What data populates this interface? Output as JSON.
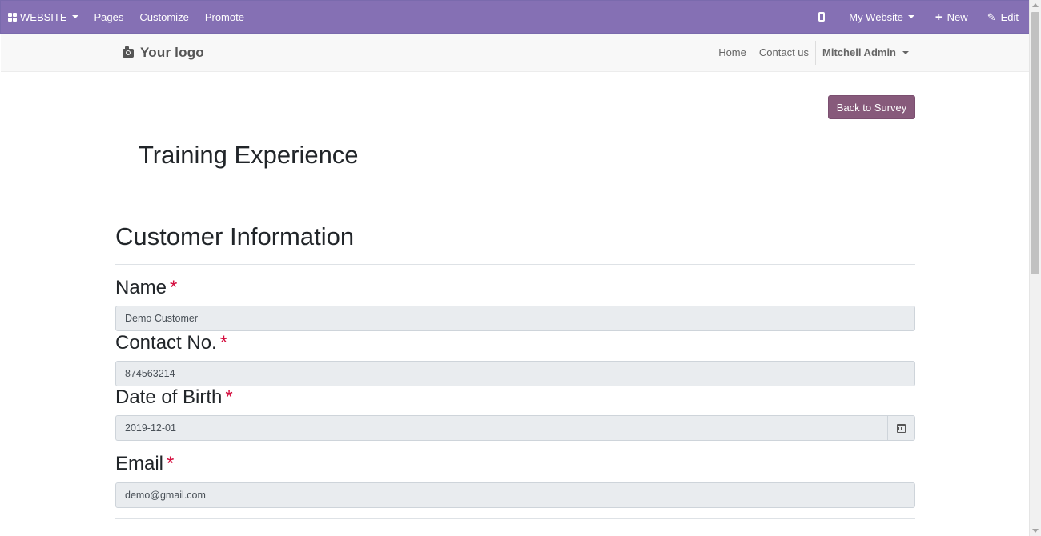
{
  "colors": {
    "accent": "#875A7B",
    "admin_bar": "#8570b4",
    "required": "#d40d3e"
  },
  "topbar": {
    "website_label": "WEBSITE",
    "website_icon": "grid-icon",
    "pages_label": "Pages",
    "customize_label": "Customize",
    "promote_label": "Promote",
    "mobile_icon": "mobile-icon",
    "my_website_label": "My Website",
    "new_label": "New",
    "new_icon": "plus-icon",
    "edit_label": "Edit",
    "edit_icon": "pencil-icon"
  },
  "header": {
    "logo_text": "Your logo",
    "logo_icon": "camera-icon",
    "nav": [
      {
        "label": "Home"
      },
      {
        "label": "Contact us"
      }
    ],
    "user_label": "Mitchell Admin"
  },
  "main": {
    "back_button_label": "Back to Survey",
    "survey_title": "Training Experience",
    "section_title": "Customer Information",
    "questions": [
      {
        "label": "Name",
        "required_mark": "*",
        "value": "Demo Customer"
      },
      {
        "label": "Contact No.",
        "required_mark": "*",
        "value": "874563214"
      },
      {
        "label": "Date of Birth",
        "required_mark": "*",
        "value": "2019-12-01",
        "icon": "calendar-icon"
      },
      {
        "label": "Email",
        "required_mark": "*",
        "value": "demo@gmail.com"
      }
    ]
  }
}
